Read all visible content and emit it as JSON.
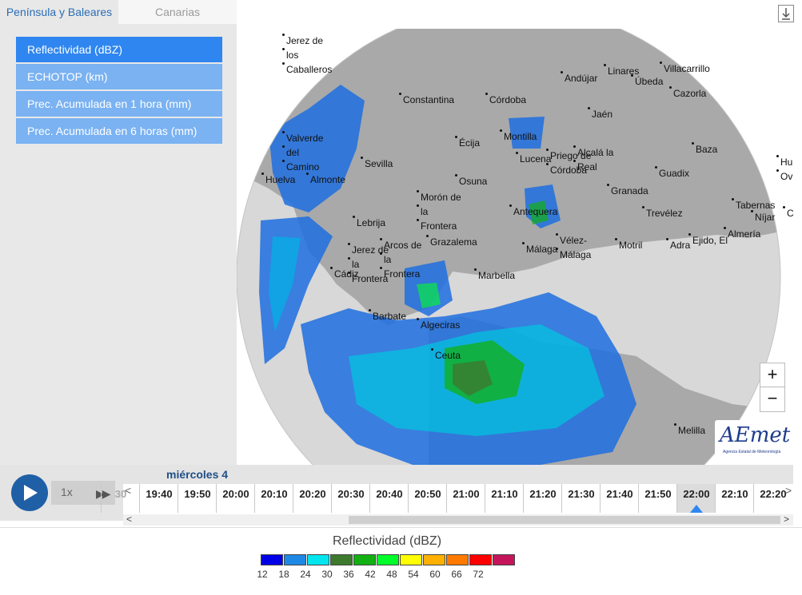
{
  "tabs": [
    {
      "label": "Península y Baleares",
      "active": true
    },
    {
      "label": "Canarias",
      "active": false
    }
  ],
  "download_icon": "download-icon",
  "products": [
    {
      "label": "Reflectividad (dBZ)",
      "active": true
    },
    {
      "label": "ECHOTOP (km)",
      "active": false
    },
    {
      "label": "Prec. Acumulada en 1 hora (mm)",
      "active": false
    },
    {
      "label": "Prec. Acumulada en 6 horas (mm)",
      "active": false
    }
  ],
  "map": {
    "cities": [
      "Jerez de los Caballeros",
      "Andújar",
      "Linares",
      "Villacarrillo",
      "Úbeda",
      "Constantina",
      "Córdoba",
      "Cazorla",
      "Jaén",
      "Montilla",
      "Valverde del Camino",
      "Écija",
      "Priego de Córdoba",
      "Alcalá la Real",
      "Baza",
      "Lucena",
      "Sevilla",
      "Huelva",
      "Almonte",
      "Guadix",
      "Osuna",
      "Granada",
      "Morón de la Frontera",
      "Tabernas",
      "Antequera",
      "Trevélez",
      "Níjar",
      "Lebrija",
      "Almería",
      "Grazalema",
      "Arcos de la Frontera",
      "Jerez de la Frontera",
      "Vélez-Málaga",
      "Motril",
      "Adra",
      "Ejido, El",
      "Málaga",
      "Cádiz",
      "Marbella",
      "Barbate",
      "Algeciras",
      "Ceuta",
      "Melilla",
      "Hu",
      "Ov",
      "C"
    ],
    "zoom_in": "+",
    "zoom_out": "−",
    "logo_text": "AEmet",
    "logo_sub": "Agencia Estatal de Meteorología"
  },
  "player": {
    "speed": "1x",
    "play_icon": "play-icon",
    "ff_icon": "fast-forward-icon"
  },
  "timeline": {
    "day": "miércoles 4",
    "times": [
      "30",
      "19:40",
      "19:50",
      "20:00",
      "20:10",
      "20:20",
      "20:30",
      "20:40",
      "20:50",
      "21:00",
      "21:10",
      "21:20",
      "21:30",
      "21:40",
      "21:50",
      "22:00",
      "22:10",
      "22:20"
    ],
    "selected": "22:00",
    "left_arrow": "<",
    "right_arrow": ">",
    "scroll_left": "<",
    "scroll_right": ">"
  },
  "legend": {
    "title": "Reflectividad (dBZ)",
    "colors": [
      "#0000e6",
      "#1e88e5",
      "#00e5ee",
      "#3d7a2e",
      "#12b012",
      "#00ff2a",
      "#ffff00",
      "#ffb000",
      "#ff7a00",
      "#ff0000",
      "#c4155a"
    ],
    "ticks": [
      "12",
      "18",
      "24",
      "30",
      "36",
      "42",
      "48",
      "54",
      "60",
      "66",
      "72"
    ]
  }
}
